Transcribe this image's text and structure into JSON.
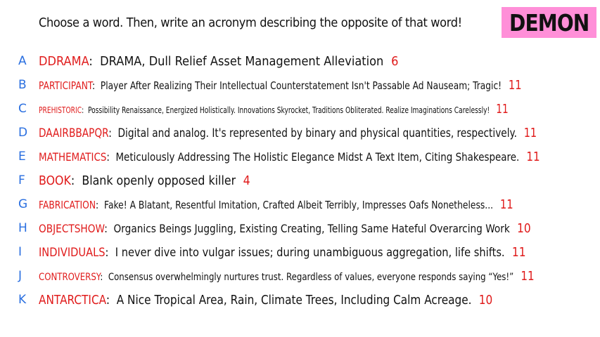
{
  "prompt": "Choose a word. Then, write an acronym describing the opposite of that word!",
  "badge": "DEMON",
  "colors": {
    "letter": "#2a6fe0",
    "word": "#e01b1b",
    "count": "#e01b1b",
    "badge_bg": "#ff8fd8"
  },
  "answers": [
    {
      "letter": "A",
      "word": "DDRAMA",
      "acronym": "DRAMA, Dull Relief Asset Management Alleviation",
      "count": "6"
    },
    {
      "letter": "B",
      "word": "PARTICIPANT",
      "acronym": "Player After Realizing Their Intellectual Counterstatement Isn't Passable Ad Nauseam; Tragic!",
      "count": "11"
    },
    {
      "letter": "C",
      "word": "PREHISTORIC",
      "acronym": "Possibility Renaissance, Energized Holistically. Innovations Skyrocket, Traditions Obliterated. Realize Imaginations Carelessly!",
      "count": "11"
    },
    {
      "letter": "D",
      "word": "DAAIRBBAPQR",
      "acronym": "Digital and analog. It's represented by binary and physical quantities, respectively.",
      "count": "11"
    },
    {
      "letter": "E",
      "word": "MATHEMATICS",
      "acronym": "Meticulously Addressing The Holistic Elegance Midst A Text Item, Citing Shakespeare.",
      "count": "11"
    },
    {
      "letter": "F",
      "word": "BOOK",
      "acronym": "Blank openly opposed killer",
      "count": "4"
    },
    {
      "letter": "G",
      "word": "FABRICATION",
      "acronym": "Fake! A Blatant, Resentful Imitation, Crafted Albeit Terribly, Impresses Oafs Nonetheless...",
      "count": "11"
    },
    {
      "letter": "H",
      "word": "OBJECTSHOW",
      "acronym": "Organics Beings Juggling, Existing Creating, Telling Same Hateful Overarcing Work",
      "count": "10"
    },
    {
      "letter": "I",
      "word": "INDIVIDUALS",
      "acronym": "I never dive into vulgar issues; during unambiguous aggregation, life shifts.",
      "count": "11"
    },
    {
      "letter": "J",
      "word": "CONTROVERSY",
      "acronym": "Consensus overwhelmingly nurtures trust. Regardless of values, everyone responds saying “Yes!”",
      "count": "11"
    },
    {
      "letter": "K",
      "word": "ANTARCTICA",
      "acronym": "A Nice Tropical Area, Rain, Climate Trees, Including Calm Acreage.",
      "count": "10"
    }
  ]
}
